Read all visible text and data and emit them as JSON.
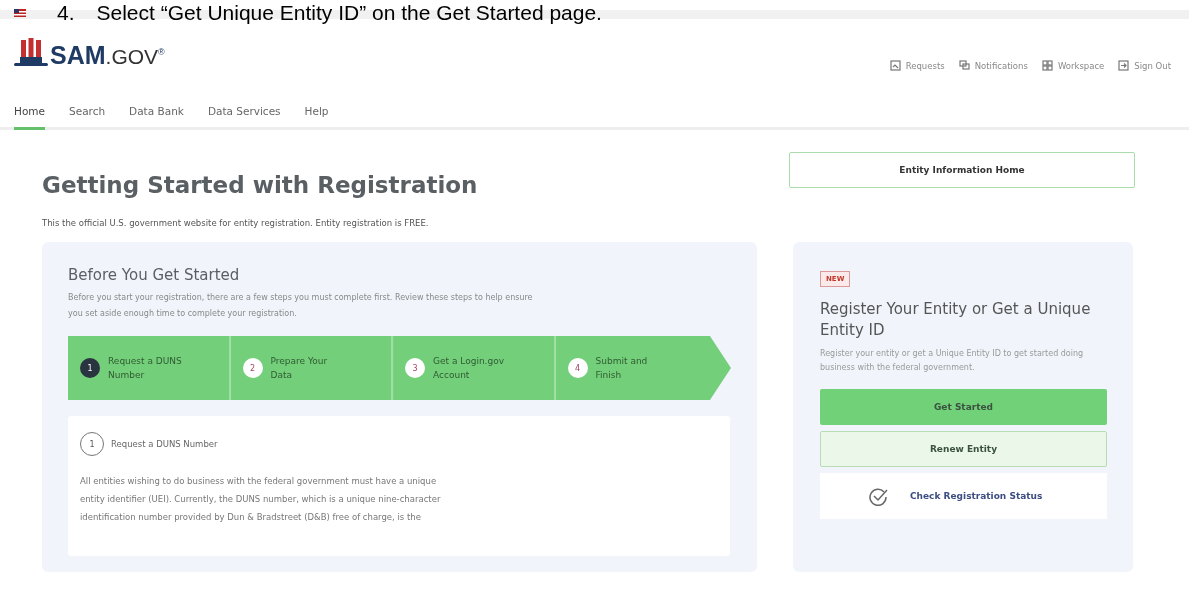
{
  "instruction": {
    "number": "4.",
    "text": "Select “Get Unique Entity ID” on the Get Started page."
  },
  "header": {
    "logo": {
      "brand": "SAM",
      "suffix": ".GOV",
      "mark": "®"
    },
    "links": [
      {
        "label": "Requests",
        "kind": "requests"
      },
      {
        "label": "Notifications",
        "kind": "notifications"
      },
      {
        "label": "Workspace",
        "kind": "workspace"
      },
      {
        "label": "Sign Out",
        "kind": "signout"
      }
    ]
  },
  "nav": [
    {
      "label": "Home",
      "selected": true
    },
    {
      "label": "Search",
      "selected": false
    },
    {
      "label": "Data Bank",
      "selected": false
    },
    {
      "label": "Data Services",
      "selected": false
    },
    {
      "label": "Help",
      "selected": false
    }
  ],
  "page": {
    "title": "Getting Started with Registration",
    "intro": "This the official U.S. government website for entity registration. Entity registration is FREE.",
    "side_button": "Entity Information Home"
  },
  "before": {
    "title": "Before You Get Started",
    "text": "Before you start your registration, there are a few steps you must complete first. Review these steps to help ensure you set aside enough time to complete your registration.",
    "steps": [
      {
        "number": "1",
        "label": "Request a DUNS Number",
        "selected": true
      },
      {
        "number": "2",
        "label": "Prepare Your Data",
        "selected": false
      },
      {
        "number": "3",
        "label": "Get a Login.gov Account",
        "selected": false
      },
      {
        "number": "4",
        "label": "Submit and Finish",
        "selected": false
      }
    ],
    "detail": {
      "number": "1",
      "title": "Request a DUNS Number",
      "lines": [
        "All entities wishing to do business with the federal government must have a unique",
        "entity identifier (UEI). Currently, the DUNS number, which is a unique nine-character",
        "identification number provided by Dun & Bradstreet (D&B) free of charge, is the"
      ]
    }
  },
  "register": {
    "badge": "NEW",
    "title": "Register Your Entity or Get a Unique Entity ID",
    "text": "Register your entity or get a Unique Entity ID to get started doing business with the federal government.",
    "buttons": [
      {
        "label": "Get Started",
        "kind": "primary"
      },
      {
        "label": "Renew Entity",
        "kind": "secondary"
      }
    ],
    "status_link": "Check Registration Status"
  }
}
